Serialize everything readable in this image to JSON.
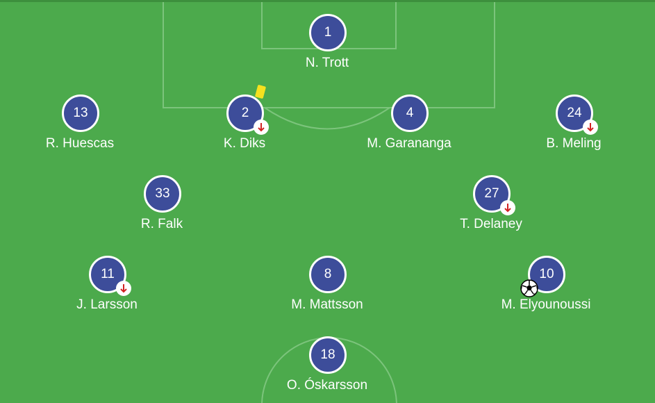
{
  "colors": {
    "pitch": "#4caa4c",
    "lines": "#7cc47c",
    "player_circle": "#3d4d9a",
    "card": "#f5e11f",
    "sub_arrow": "#d22121"
  },
  "players": [
    {
      "number": "1",
      "name": "N. Trott",
      "icons": []
    },
    {
      "number": "13",
      "name": "R. Huescas",
      "icons": []
    },
    {
      "number": "2",
      "name": "K. Diks",
      "icons": [
        "yellow-card",
        "sub-off"
      ]
    },
    {
      "number": "4",
      "name": "M. Garananga",
      "icons": []
    },
    {
      "number": "24",
      "name": "B. Meling",
      "icons": [
        "sub-off"
      ]
    },
    {
      "number": "33",
      "name": "R. Falk",
      "icons": []
    },
    {
      "number": "27",
      "name": "T. Delaney",
      "icons": [
        "sub-off"
      ]
    },
    {
      "number": "11",
      "name": "J. Larsson",
      "icons": [
        "sub-off"
      ]
    },
    {
      "number": "8",
      "name": "M. Mattsson",
      "icons": []
    },
    {
      "number": "10",
      "name": "M. Elyounoussi",
      "icons": [
        "goal"
      ]
    },
    {
      "number": "18",
      "name": "O. Óskarsson",
      "icons": []
    }
  ]
}
